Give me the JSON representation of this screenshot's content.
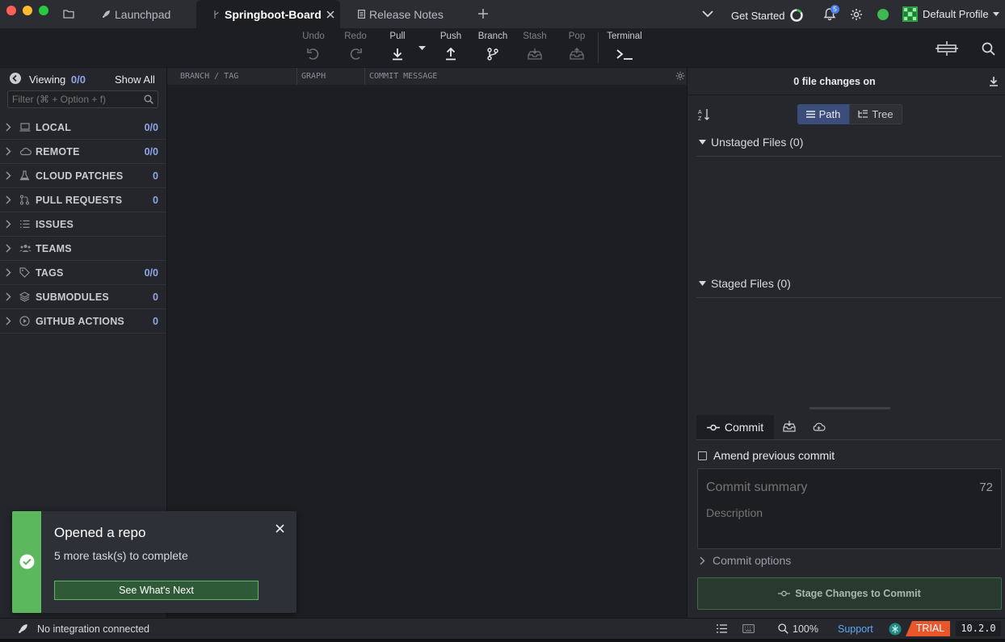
{
  "tabs": [
    {
      "label": "Launchpad"
    },
    {
      "label": "Springboot-Board"
    },
    {
      "label": "Release Notes"
    }
  ],
  "header": {
    "get_started": "Get Started",
    "notification_count": "5",
    "profile_name": "Default Profile"
  },
  "toolbar": {
    "undo": "Undo",
    "redo": "Redo",
    "pull": "Pull",
    "push": "Push",
    "branch": "Branch",
    "stash": "Stash",
    "pop": "Pop",
    "terminal": "Terminal"
  },
  "sidebar": {
    "viewing_label": "Viewing",
    "viewing_count": "0/0",
    "show_all": "Show All",
    "filter_placeholder": "Filter (⌘ + Option + f)",
    "items": [
      {
        "label": "LOCAL",
        "count": "0/0",
        "icon": "laptop-icon"
      },
      {
        "label": "REMOTE",
        "count": "0/0",
        "icon": "cloud-icon"
      },
      {
        "label": "CLOUD PATCHES",
        "count": "0",
        "icon": "flask-icon"
      },
      {
        "label": "PULL REQUESTS",
        "count": "0",
        "icon": "pull-request-icon"
      },
      {
        "label": "ISSUES",
        "count": "",
        "icon": "list-icon"
      },
      {
        "label": "TEAMS",
        "count": "",
        "icon": "people-icon"
      },
      {
        "label": "TAGS",
        "count": "0/0",
        "icon": "tag-icon"
      },
      {
        "label": "SUBMODULES",
        "count": "0",
        "icon": "layers-icon"
      },
      {
        "label": "GITHUB ACTIONS",
        "count": "0",
        "icon": "play-circle-icon"
      }
    ]
  },
  "graph": {
    "columns": [
      "BRANCH / TAG",
      "GRAPH",
      "COMMIT MESSAGE"
    ]
  },
  "right_panel": {
    "file_changes": "0 file changes on",
    "view_path": "Path",
    "view_tree": "Tree",
    "unstaged": "Unstaged Files (0)",
    "staged": "Staged Files (0)",
    "commit_tab": "Commit",
    "amend": "Amend previous commit",
    "summary_placeholder": "Commit summary",
    "summary_remaining": "72",
    "description_placeholder": "Description",
    "commit_options": "Commit options",
    "stage_button": "Stage Changes to Commit"
  },
  "toast": {
    "title": "Opened a repo",
    "subtitle": "5 more task(s) to complete",
    "button": "See What's Next"
  },
  "statusbar": {
    "integration": "No integration connected",
    "zoom": "100%",
    "support": "Support",
    "trial": "TRIAL",
    "version": "10.2.0"
  },
  "colors": {
    "accent_blue": "#8fa6e6",
    "toast_green": "#5cb85c",
    "trial_orange": "#e8562a",
    "online_green": "#3fb950"
  }
}
